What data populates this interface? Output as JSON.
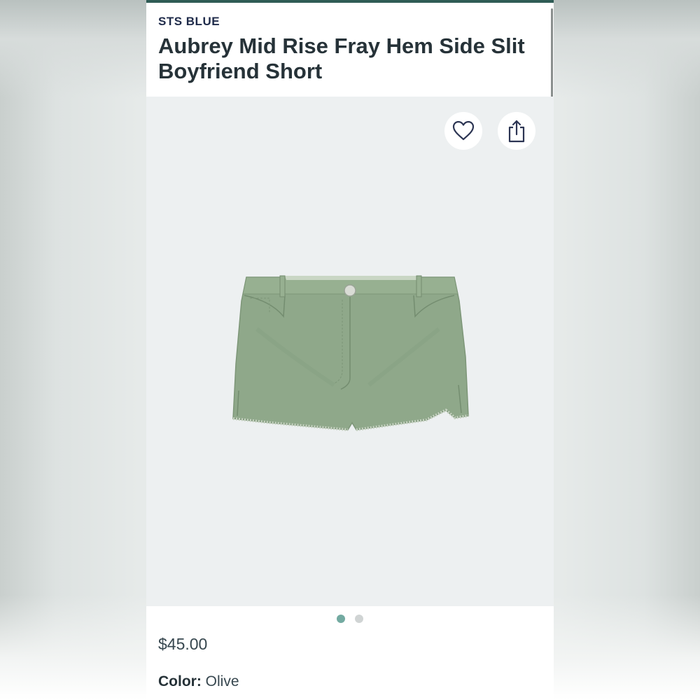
{
  "product": {
    "brand": "STS BLUE",
    "title": "Aubrey Mid Rise Fray Hem Side Slit Boyfriend Short",
    "price": "$45.00",
    "color_label": "Color:",
    "color_value": "Olive"
  },
  "gallery": {
    "image_count": 2,
    "active_index": 0,
    "favorite_icon": "heart-icon",
    "share_icon": "share-icon"
  },
  "colors": {
    "accent_bar": "#2f5c55",
    "brand_text": "#1f2b4a",
    "active_dot": "#73aaa1",
    "inactive_dot": "#d0d4d4",
    "shorts": "#8fa88a"
  }
}
